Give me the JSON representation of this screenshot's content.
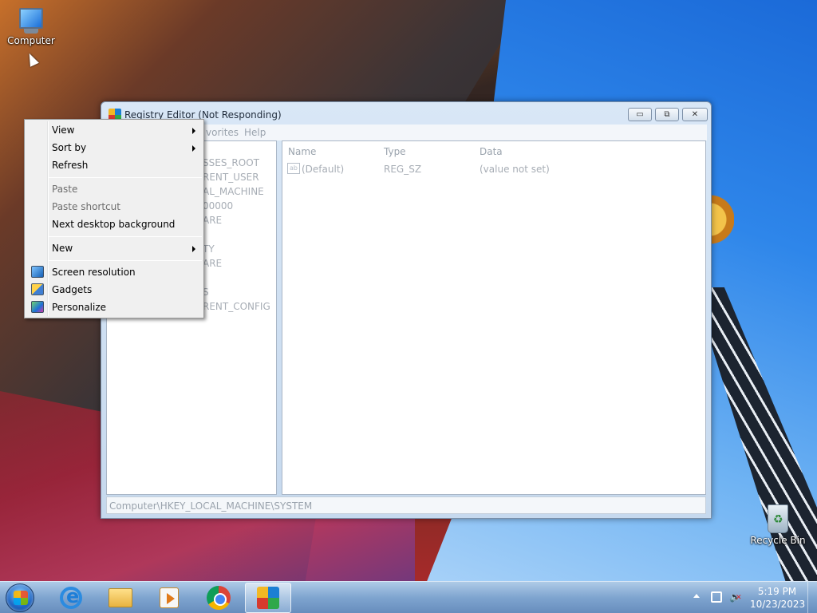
{
  "desktop": {
    "icons": [
      {
        "label": "Computer"
      },
      {
        "label": "Recycle Bin"
      }
    ]
  },
  "registry_window": {
    "title": "Registry Editor (Not Responding)",
    "menu": [
      "vorites",
      "Help"
    ],
    "tree": [
      "SSES_ROOT",
      "RENT_USER",
      "AL_MACHINE",
      "00000",
      "ARE",
      "TY",
      "ARE",
      "S",
      "RENT_CONFIG"
    ],
    "columns": {
      "name": "Name",
      "type": "Type",
      "data": "Data"
    },
    "row": {
      "name": "(Default)",
      "type": "REG_SZ",
      "data": "(value not set)",
      "icon": "ab"
    },
    "status": "Computer\\HKEY_LOCAL_MACHINE\\SYSTEM",
    "buttons": {
      "minimize": "▭",
      "maximize": "⧉",
      "close": "✕"
    }
  },
  "context_menu": {
    "items": [
      {
        "label": "View",
        "submenu": true,
        "enabled": true
      },
      {
        "label": "Sort by",
        "submenu": true,
        "enabled": true
      },
      {
        "label": "Refresh",
        "enabled": true
      },
      {
        "label": "Paste",
        "enabled": false
      },
      {
        "label": "Paste shortcut",
        "enabled": false
      },
      {
        "label": "Next desktop background",
        "enabled": true
      },
      {
        "label": "New",
        "submenu": true,
        "enabled": true
      },
      {
        "label": "Screen resolution",
        "icon": "screen-resolution-icon",
        "enabled": true
      },
      {
        "label": "Gadgets",
        "icon": "gadgets-icon",
        "enabled": true
      },
      {
        "label": "Personalize",
        "icon": "personalize-icon",
        "enabled": true
      }
    ]
  },
  "taskbar": {
    "clock_time": "5:19 PM",
    "clock_date": "10/23/2023",
    "pinned": [
      "internet-explorer-icon",
      "file-explorer-icon",
      "media-player-icon",
      "chrome-icon",
      "registry-editor-icon"
    ]
  }
}
